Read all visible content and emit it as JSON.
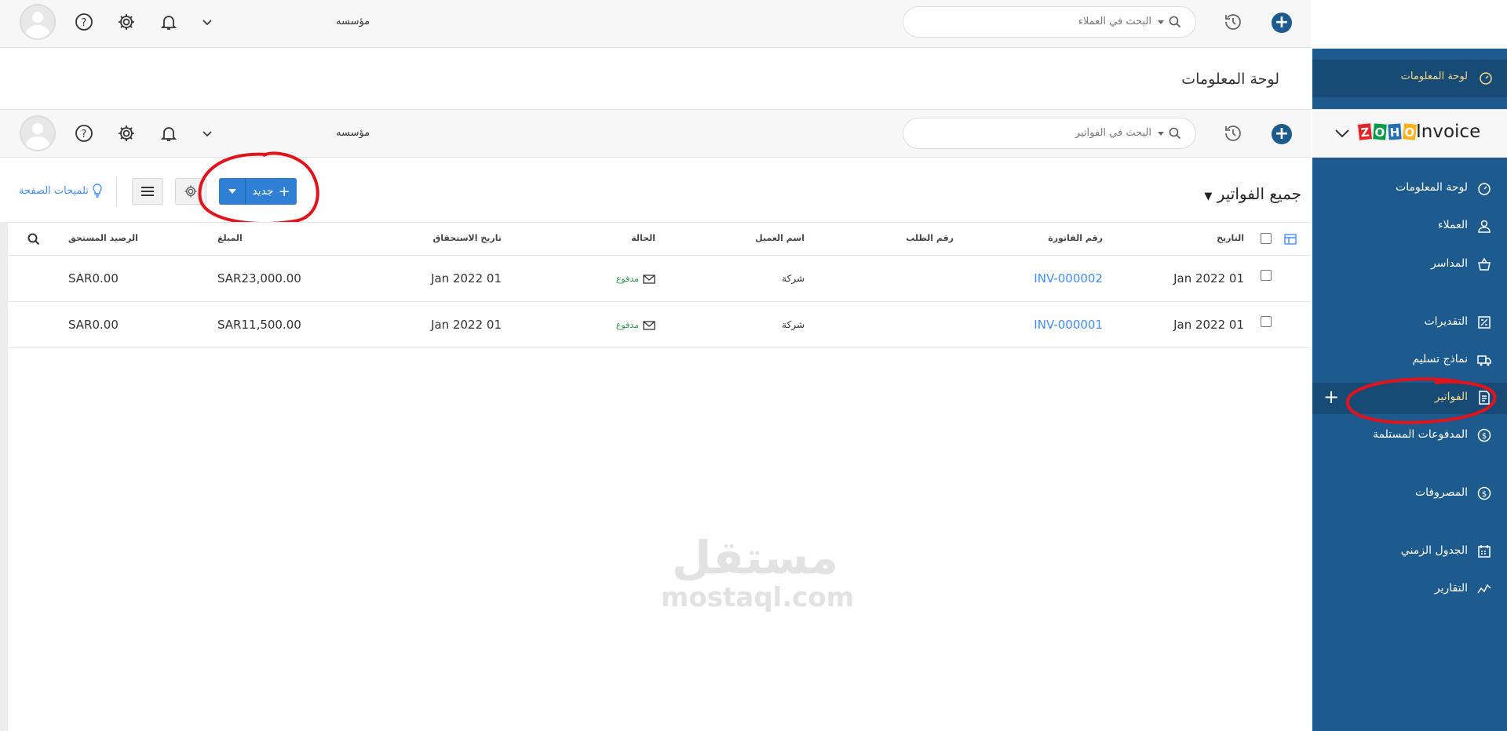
{
  "colors": {
    "sidebar_bg": "#1d5a8e",
    "accent": "#408dfb",
    "status_paid": "#2e9e4f",
    "active_label": "#f4d88a",
    "annotation": "#e3131b"
  },
  "top_header": {
    "search_placeholder": "البحث في العملاء",
    "org_name": "مؤسسه",
    "page_title": "لوحة المعلومات"
  },
  "header": {
    "search_placeholder": "البحث في الفواتير",
    "org_name": "مؤسسه"
  },
  "sidebar_top_item": {
    "label": "لوحة المعلومات",
    "icon": "dashboard-icon"
  },
  "brand": {
    "logo_letters": [
      "Z",
      "O",
      "H",
      "O"
    ],
    "product": "Invoice"
  },
  "sidebar": {
    "items": [
      {
        "label": "لوحة المعلومات",
        "icon": "dashboard-icon"
      },
      {
        "label": "العملاء",
        "icon": "user-icon"
      },
      {
        "label": "المداسر",
        "icon": "basket-icon"
      },
      {
        "label": "التقديرات",
        "icon": "estimate-icon"
      },
      {
        "label": "نماذج تسليم",
        "icon": "truck-icon"
      },
      {
        "label": "الفواتير",
        "icon": "invoice-icon"
      },
      {
        "label": "المدفوعات المستلمة",
        "icon": "payment-icon"
      },
      {
        "label": "المصروفات",
        "icon": "expense-icon"
      },
      {
        "label": "الجدول الزمني",
        "icon": "calendar-icon"
      },
      {
        "label": "التقارير",
        "icon": "chart-icon"
      }
    ]
  },
  "list": {
    "title": "جميع الفواتير",
    "new_label": "جديد",
    "tips_label": "تلميحات الصفحة",
    "columns": {
      "date": "التاريخ",
      "invoice_number": "رقم الفاتورة",
      "order_number": "رقم الطلب",
      "customer": "اسم العميل",
      "status": "الحالة",
      "due_date": "تاريخ الاستحقاق",
      "amount": "المبلغ",
      "balance_due": "الرصيد المستحق"
    },
    "rows": [
      {
        "date": "Jan 2022 01",
        "invoice_number": "INV-000002",
        "order_number": "",
        "customer": "شركة",
        "status": "مدفوع",
        "due_date": "Jan 2022 01",
        "amount": "SAR23,000.00",
        "balance_due": "SAR0.00"
      },
      {
        "date": "Jan 2022 01",
        "invoice_number": "INV-000001",
        "order_number": "",
        "customer": "شركة",
        "status": "مدفوع",
        "due_date": "Jan 2022 01",
        "amount": "SAR11,500.00",
        "balance_due": "SAR0.00"
      }
    ]
  },
  "watermark": {
    "arabic": "مستقل",
    "latin": "mostaql.com"
  }
}
